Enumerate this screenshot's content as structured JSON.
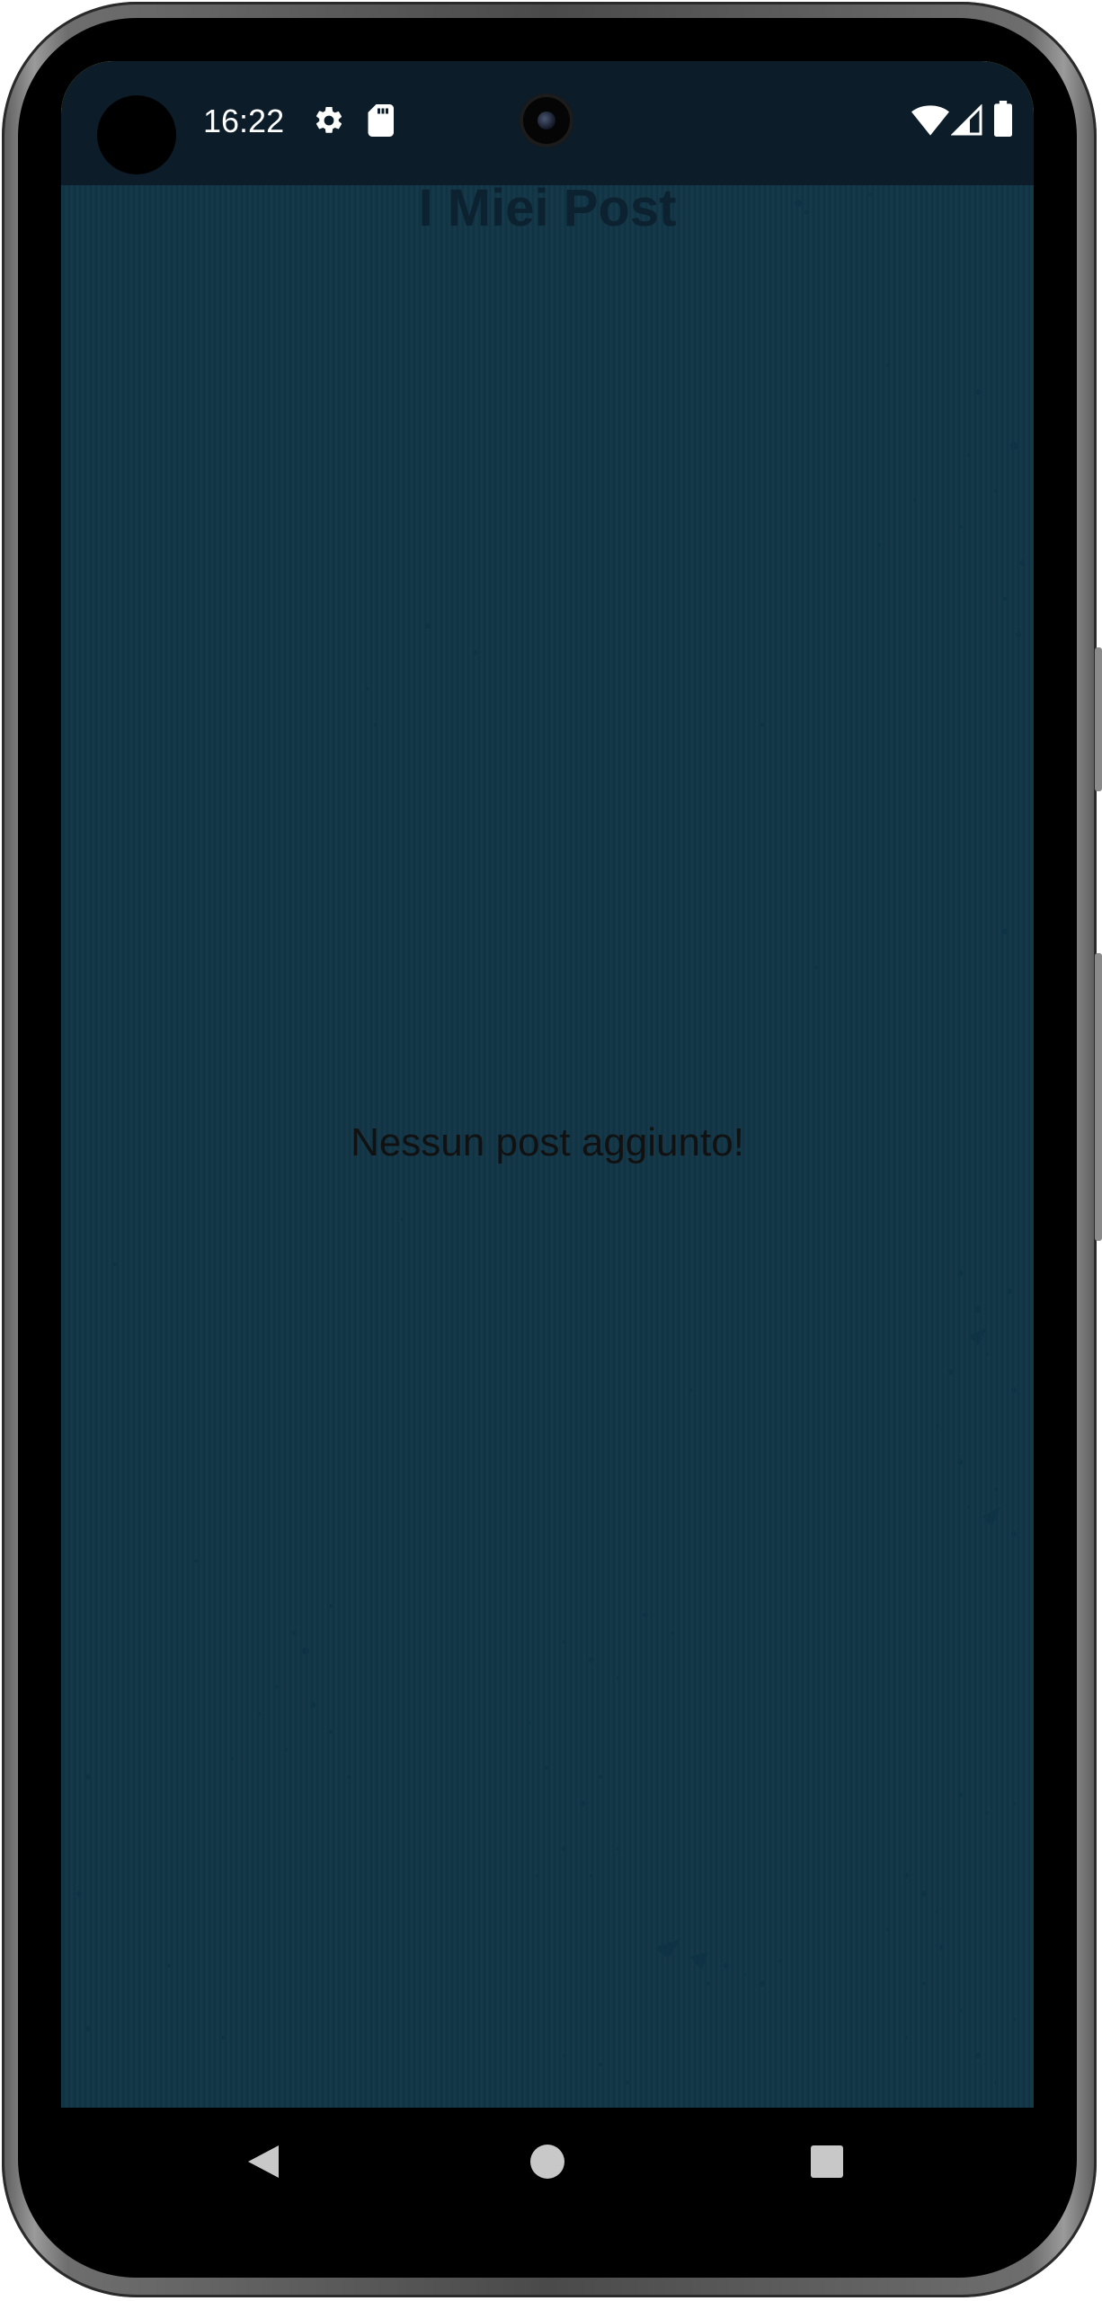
{
  "status_bar": {
    "time": "16:22",
    "icons": [
      "settings-gear-icon",
      "sd-card-icon",
      "wifi-icon",
      "cellular-signal-icon",
      "battery-icon"
    ]
  },
  "page": {
    "title": "I Miei Post",
    "empty_message": "Nessun post aggiunto!"
  },
  "navigation_bar": {
    "buttons": [
      "back-triangle-icon",
      "home-circle-icon",
      "recents-square-icon"
    ]
  },
  "colors": {
    "background": "#f8ec4e",
    "status_bar": "#0c1c28",
    "title_text": "#0c2230",
    "speckle": "#0f3344"
  }
}
